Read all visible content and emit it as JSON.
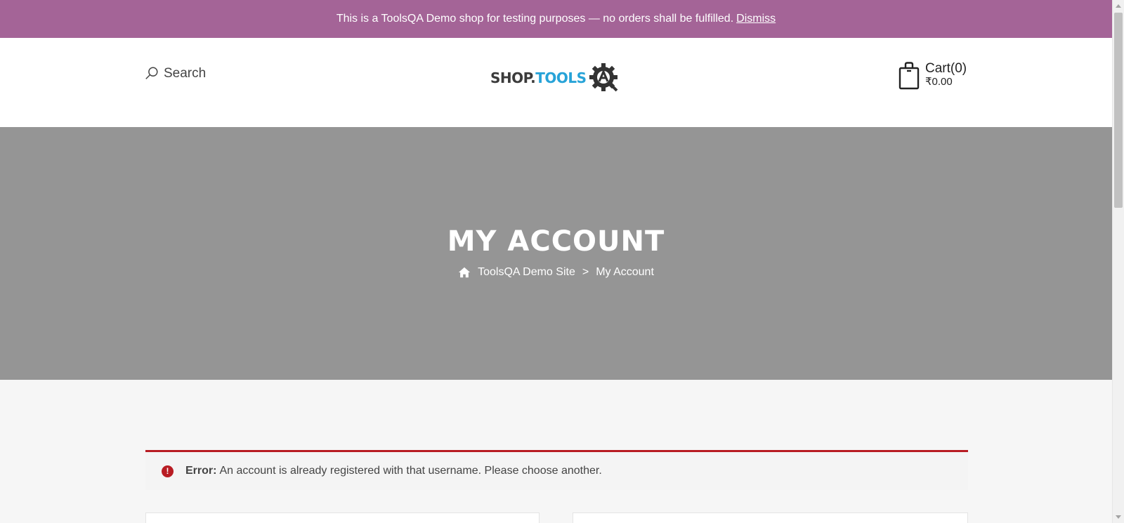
{
  "notice": {
    "text": "This is a ToolsQA Demo shop for testing purposes — no orders shall be fulfilled.",
    "dismiss_label": "Dismiss"
  },
  "header": {
    "search_label": "Search",
    "logo": {
      "part1": "SHOP.",
      "part2": "TOOLS"
    },
    "cart": {
      "label": "Cart(0)",
      "total": "₹0.00"
    }
  },
  "hero": {
    "title": "MY ACCOUNT",
    "breadcrumb": {
      "home": "ToolsQA Demo Site",
      "separator": ">",
      "current": "My Account"
    }
  },
  "error": {
    "prefix": "Error:",
    "message": "An account is already registered with that username. Please choose another."
  },
  "colors": {
    "notice_bg": "#a46497",
    "hero_bg": "#959595",
    "error_accent": "#b81c23",
    "logo_tools": "#27a3d8"
  },
  "icons": [
    "search-icon",
    "gear-a-logo-icon",
    "shopping-bag-icon",
    "home-icon",
    "error-icon"
  ]
}
